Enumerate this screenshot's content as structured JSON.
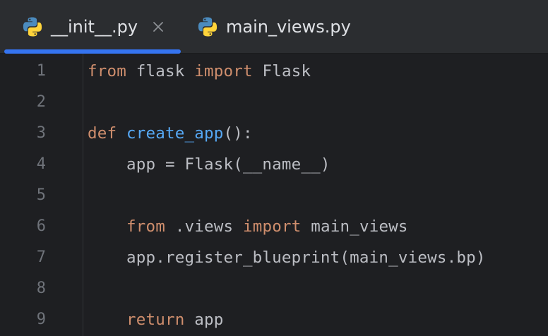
{
  "tabs": [
    {
      "label": "__init__.py",
      "active": true,
      "icon": "python-icon",
      "closable": true,
      "close_glyph": "×"
    },
    {
      "label": "main_views.py",
      "active": false,
      "icon": "python-icon",
      "closable": false
    }
  ],
  "colors": {
    "background": "#1e1f22",
    "tabbar": "#2b2d30",
    "accent": "#3574f0",
    "keyword": "#cf8e6d",
    "function": "#56a8f5",
    "text": "#bcbec4",
    "line_number": "#6f737a"
  },
  "editor": {
    "line_numbers": [
      "1",
      "2",
      "3",
      "4",
      "5",
      "6",
      "7",
      "8",
      "9"
    ],
    "lines": [
      {
        "tokens": [
          {
            "t": "from",
            "k": "kw"
          },
          {
            "t": " flask ",
            "k": "tx"
          },
          {
            "t": "import",
            "k": "kw"
          },
          {
            "t": " Flask",
            "k": "tx"
          }
        ]
      },
      {
        "tokens": []
      },
      {
        "tokens": [
          {
            "t": "def",
            "k": "kw"
          },
          {
            "t": " ",
            "k": "tx"
          },
          {
            "t": "create_app",
            "k": "fn"
          },
          {
            "t": "():",
            "k": "tx"
          }
        ]
      },
      {
        "tokens": [
          {
            "t": "    app = Flask(__name__)",
            "k": "tx"
          }
        ]
      },
      {
        "tokens": []
      },
      {
        "tokens": [
          {
            "t": "    ",
            "k": "tx"
          },
          {
            "t": "from",
            "k": "kw"
          },
          {
            "t": " .views ",
            "k": "tx"
          },
          {
            "t": "import",
            "k": "kw"
          },
          {
            "t": " main_views",
            "k": "tx"
          }
        ]
      },
      {
        "tokens": [
          {
            "t": "    app.register_blueprint(main_views.bp)",
            "k": "tx"
          }
        ]
      },
      {
        "tokens": []
      },
      {
        "tokens": [
          {
            "t": "    ",
            "k": "tx"
          },
          {
            "t": "return",
            "k": "kw"
          },
          {
            "t": " app",
            "k": "tx"
          }
        ]
      }
    ]
  }
}
